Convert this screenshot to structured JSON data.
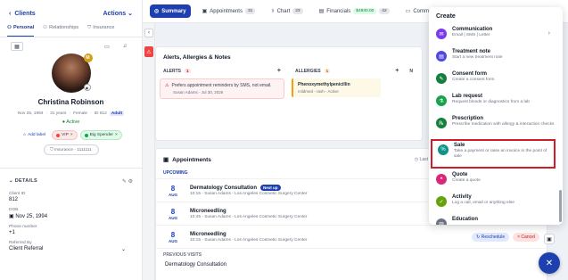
{
  "left": {
    "back_label": "Clients",
    "actions_label": "Actions",
    "tabs": [
      {
        "label": "Personal"
      },
      {
        "label": "Relationships"
      },
      {
        "label": "Insurance"
      }
    ],
    "avatar_badge": "M",
    "patient": {
      "name": "Christina Robinson",
      "dob": "Nov 25, 1994",
      "age": "31 years",
      "sex": "Female",
      "id": "ID 812",
      "group": "Adult",
      "status": "Active"
    },
    "add_label": "Add label",
    "labels": [
      {
        "label": "VIP",
        "color": "#ef4444"
      },
      {
        "label": "Big Spender",
        "color": "#16a34a"
      }
    ],
    "insurance": "Insurance - 1111111",
    "details_title": "DETAILS",
    "fields": [
      {
        "key": "Client ID",
        "value": "812"
      },
      {
        "key": "DOB",
        "value": "Nov 25, 1994"
      },
      {
        "key": "Phone number",
        "value": "+1"
      },
      {
        "key": "Referred By",
        "value": "Client Referral"
      }
    ]
  },
  "nav": {
    "tabs": [
      {
        "label": "Summary",
        "active": true,
        "badge": ""
      },
      {
        "label": "Appointments",
        "badge": "31"
      },
      {
        "label": "Chart",
        "badge": "23"
      },
      {
        "label": "Financials",
        "badge": "$4930.00",
        "badge2": "42"
      },
      {
        "label": "Commu"
      }
    ]
  },
  "alerts": {
    "title": "Alerts, Allergies & Notes",
    "alerts_label": "ALERTS",
    "alerts_count": "1",
    "allergies_label": "ALLERGIES",
    "allergies_count": "1",
    "notes_label": "N",
    "alert_text": "Prefers appointment reminders by SMS, not email.",
    "alert_meta": "Susan Adams - Jul 30, 2026",
    "allergy_name": "Phenoxymethylpenicillin",
    "allergy_meta": "mildmed - rash - Active"
  },
  "appointments": {
    "title": "Appointments",
    "upcoming_label": "UPCOMING",
    "last_visit_label": "Last vi",
    "previous_label": "PREVIOUS VISITS",
    "previous_first": "Dermatology Consultation",
    "items": [
      {
        "day": "8",
        "month": "AUG",
        "name": "Dermatology Consultation",
        "tag": "Next up",
        "meta": "10:15 - Susan Adams - Los Angeles Cosmetic Surgery Center"
      },
      {
        "day": "8",
        "month": "AUG",
        "name": "Microneedling",
        "meta": "10:45 - Susan Adams - Los Angeles Cosmetic Surgery Center"
      },
      {
        "day": "8",
        "month": "AUG",
        "name": "Microneedling",
        "meta": "10:15 - Susan Adams - Los Angeles Cosmetic Surgery Center",
        "reschedule": "Reschedule",
        "cancel": "Cancel"
      }
    ]
  },
  "create_menu": {
    "title": "Create",
    "items": [
      {
        "title": "Communication",
        "desc": "Email | SMS | Letter",
        "color": "#7c3aed",
        "icon": "chat-icon"
      },
      {
        "title": "Treatment note",
        "desc": "Start a new treatment note",
        "color": "#4f46e5",
        "icon": "note-icon"
      },
      {
        "title": "Consent form",
        "desc": "Create a consent form",
        "color": "#15803d",
        "icon": "pen-icon"
      },
      {
        "title": "Lab request",
        "desc": "Request bloods or diagnostics from a lab",
        "color": "#16a34a",
        "icon": "flask-icon"
      },
      {
        "title": "Prescription",
        "desc": "Prescribe medication with allergy & interaction checks",
        "color": "#15803d",
        "icon": "pill-icon"
      },
      {
        "title": "Sale",
        "desc": "Take a payment or raise an invoice in the point of sale",
        "color": "#0d9488",
        "icon": "percent-icon"
      },
      {
        "title": "Quote",
        "desc": "Create a quote",
        "color": "#db2777",
        "icon": "quote-icon"
      },
      {
        "title": "Activity",
        "desc": "Log a call, email or anything else",
        "color": "#65a30d",
        "icon": "check-icon"
      },
      {
        "title": "Education",
        "desc": "",
        "color": "#6b7280",
        "icon": "book-icon"
      }
    ]
  }
}
